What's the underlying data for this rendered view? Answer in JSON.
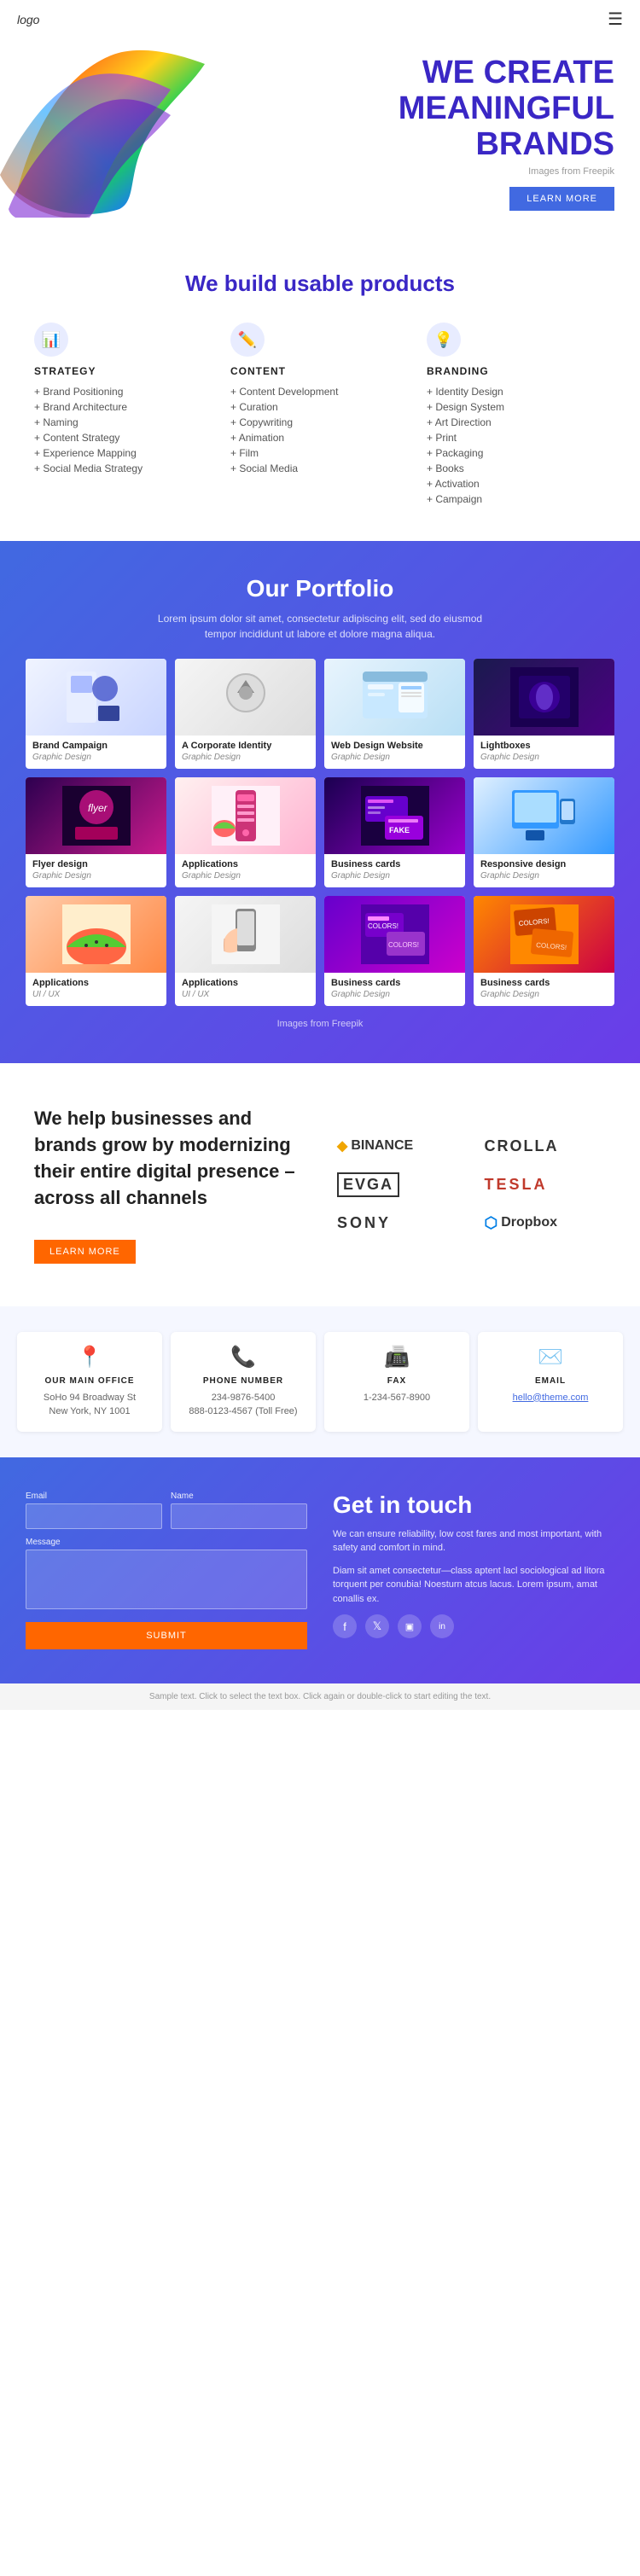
{
  "header": {
    "logo": "logo",
    "hamburger_label": "☰"
  },
  "hero": {
    "title_line1": "WE CREATE",
    "title_line2": "MEANINGFUL",
    "title_line3": "BRANDS",
    "image_credit": "Images from Freepik",
    "button_label": "LEARN MORE"
  },
  "build_section": {
    "heading": "We build usable products",
    "columns": [
      {
        "icon": "📊",
        "title": "STRATEGY",
        "items": [
          "Brand Positioning",
          "Brand Architecture",
          "Naming",
          "Content Strategy",
          "Experience Mapping",
          "Social Media Strategy"
        ]
      },
      {
        "icon": "✏️",
        "title": "CONTENT",
        "items": [
          "Content Development",
          "Curation",
          "Copywriting",
          "Animation",
          "Film",
          "Social Media"
        ]
      },
      {
        "icon": "💡",
        "title": "BRANDING",
        "items": [
          "Identity Design",
          "Design System",
          "Art Direction",
          "Print",
          "Packaging",
          "Books",
          "Activation",
          "Campaign"
        ]
      }
    ]
  },
  "portfolio_section": {
    "heading": "Our Portfolio",
    "description": "Lorem ipsum dolor sit amet, consectetur adipiscing elit, sed do eiusmod tempor incididunt ut labore et dolore magna aliqua.",
    "freepik_text": "Images from Freepik",
    "items": [
      {
        "title": "Brand Campaign",
        "category": "Graphic Design",
        "img_class": "img-brand"
      },
      {
        "title": "A Corporate Identity",
        "category": "Graphic Design",
        "img_class": "img-corporate"
      },
      {
        "title": "Web Design Website",
        "category": "Graphic Design",
        "img_class": "img-webdesign"
      },
      {
        "title": "Lightboxes",
        "category": "Graphic Design",
        "img_class": "img-lightbox"
      },
      {
        "title": "Flyer design",
        "category": "Graphic Design",
        "img_class": "img-flyer"
      },
      {
        "title": "Applications",
        "category": "Graphic Design",
        "img_class": "img-apps"
      },
      {
        "title": "Business cards",
        "category": "Graphic Design",
        "img_class": "img-bizcard"
      },
      {
        "title": "Responsive design",
        "category": "Graphic Design",
        "img_class": "img-responsive"
      },
      {
        "title": "Applications",
        "category": "UI / UX",
        "img_class": "img-apps2"
      },
      {
        "title": "Applications",
        "category": "UI / UX",
        "img_class": "img-apps3"
      },
      {
        "title": "Business cards",
        "category": "Graphic Design",
        "img_class": "img-bizcard2"
      },
      {
        "title": "Business cards",
        "category": "Graphic Design",
        "img_class": "img-bizcard3"
      }
    ]
  },
  "brands_section": {
    "heading": "We help businesses and brands grow by modernizing their entire digital presence – across all channels",
    "button_label": "LEARN MORE",
    "logos": [
      {
        "name": "BINANCE",
        "symbol": "◆"
      },
      {
        "name": "CROLLA",
        "symbol": ""
      },
      {
        "name": "EVGA",
        "symbol": ""
      },
      {
        "name": "TESLA",
        "symbol": ""
      },
      {
        "name": "SONY",
        "symbol": ""
      },
      {
        "name": "Dropbox",
        "symbol": "📦"
      }
    ]
  },
  "contact_info": {
    "cards": [
      {
        "icon": "📍",
        "title": "OUR MAIN OFFICE",
        "text": "SoHo 94 Broadway St\nNew York, NY 1001"
      },
      {
        "icon": "📞",
        "title": "PHONE NUMBER",
        "text": "234-9876-5400\n888-0123-4567 (Toll Free)"
      },
      {
        "icon": "📠",
        "title": "FAX",
        "text": "1-234-567-8900"
      },
      {
        "icon": "✉️",
        "title": "EMAIL",
        "text": "hello@theme.com"
      }
    ]
  },
  "get_in_touch": {
    "heading": "Get in touch",
    "tagline": "We can ensure reliability, low cost fares and most important, with safety and comfort in mind.",
    "lorem": "Diam sit amet consectetur—class aptent lacl sociological ad litora torquent per conubia! Noesturn atcus lacus. Lorem ipsum, amat conallis ex.",
    "form": {
      "email_label": "Email",
      "name_label": "Name",
      "message_label": "Message",
      "submit_label": "SUBMIT",
      "email_placeholder": "",
      "name_placeholder": "",
      "message_placeholder": ""
    },
    "social": [
      {
        "icon": "f",
        "name": "facebook"
      },
      {
        "icon": "𝕏",
        "name": "twitter"
      },
      {
        "icon": "📷",
        "name": "instagram"
      },
      {
        "icon": "in",
        "name": "linkedin"
      }
    ]
  },
  "footer": {
    "note": "Sample text. Click to select the text box. Click again or double-click to start editing the text."
  }
}
